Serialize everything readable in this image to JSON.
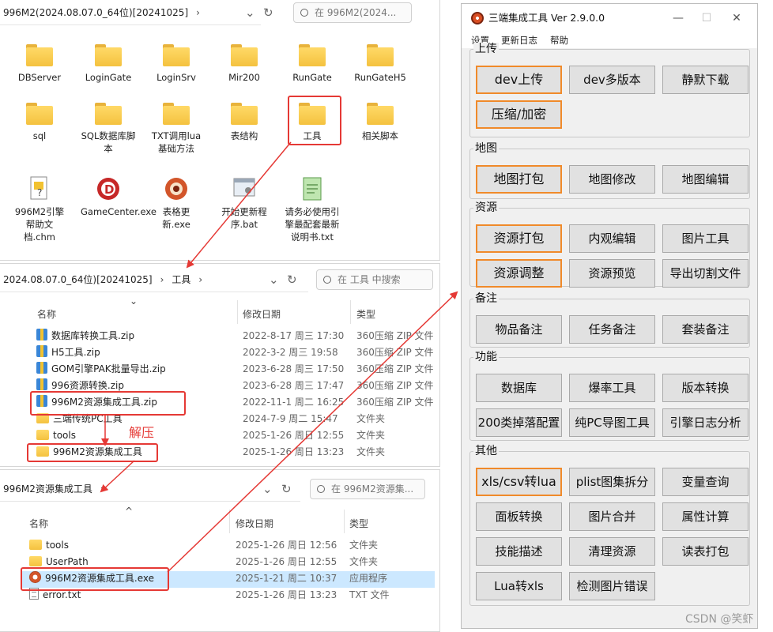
{
  "window1": {
    "breadcrumb": "996M2(2024.08.07.0_64位)[20241025]",
    "search_placeholder": "在 996M2(2024...",
    "tiles": [
      {
        "label": "DBServer",
        "kind": "folder"
      },
      {
        "label": "LoginGate",
        "kind": "folder"
      },
      {
        "label": "LoginSrv",
        "kind": "folder"
      },
      {
        "label": "Mir200",
        "kind": "folder"
      },
      {
        "label": "RunGate",
        "kind": "folder"
      },
      {
        "label": "RunGateH5",
        "kind": "folder"
      },
      {
        "label": "sql",
        "kind": "folder"
      },
      {
        "label": "SQL数据库脚本",
        "kind": "folder"
      },
      {
        "label": "TXT调用lua基础方法",
        "kind": "folder"
      },
      {
        "label": "表结构",
        "kind": "folder"
      },
      {
        "label": "工具",
        "kind": "folder"
      },
      {
        "label": "相关脚本",
        "kind": "folder"
      },
      {
        "label": "996M2引擎帮助文档.chm",
        "kind": "chm"
      },
      {
        "label": "GameCenter.exe",
        "kind": "exe-d"
      },
      {
        "label": "表格更新.exe",
        "kind": "exe-dragon"
      },
      {
        "label": "开始更新程序.bat",
        "kind": "bat"
      },
      {
        "label": "请务必使用引擎最配套最新说明书.txt",
        "kind": "txt"
      }
    ]
  },
  "window2": {
    "breadcrumb_part1": "2024.08.07.0_64位)[20241025]",
    "breadcrumb_part2": "工具",
    "search_placeholder": "在 工具 中搜索",
    "col_name": "名称",
    "col_date": "修改日期",
    "col_type": "类型",
    "rows": [
      {
        "name": "数据库转换工具.zip",
        "date": "2022-8-17 周三 17:30",
        "type": "360压缩 ZIP 文件",
        "kind": "zip"
      },
      {
        "name": "H5工具.zip",
        "date": "2022-3-2 周三 19:58",
        "type": "360压缩 ZIP 文件",
        "kind": "zip"
      },
      {
        "name": "GOM引擎PAK批量导出.zip",
        "date": "2023-6-28 周三 17:50",
        "type": "360压缩 ZIP 文件",
        "kind": "zip"
      },
      {
        "name": "996资源转换.zip",
        "date": "2023-6-28 周三 17:47",
        "type": "360压缩 ZIP 文件",
        "kind": "zip"
      },
      {
        "name": "996M2资源集成工具.zip",
        "date": "2022-11-1 周二 16:25",
        "type": "360压缩 ZIP 文件",
        "kind": "zip"
      },
      {
        "name": "三端传统PC工具",
        "date": "2024-7-9 周二 15:47",
        "type": "文件夹",
        "kind": "folder"
      },
      {
        "name": "tools",
        "date": "2025-1-26 周日 12:55",
        "type": "文件夹",
        "kind": "folder"
      },
      {
        "name": "996M2资源集成工具",
        "date": "2025-1-26 周日 13:23",
        "type": "文件夹",
        "kind": "folder"
      }
    ]
  },
  "window3": {
    "breadcrumb": "996M2资源集成工具",
    "search_placeholder": "在 996M2资源集...",
    "col_name": "名称",
    "col_date": "修改日期",
    "col_type": "类型",
    "rows": [
      {
        "name": "tools",
        "date": "2025-1-26 周日 12:56",
        "type": "文件夹",
        "kind": "folder"
      },
      {
        "name": "UserPath",
        "date": "2025-1-26 周日 12:55",
        "type": "文件夹",
        "kind": "folder"
      },
      {
        "name": "996M2资源集成工具.exe",
        "date": "2025-1-21 周二 10:37",
        "type": "应用程序",
        "kind": "exe"
      },
      {
        "name": "error.txt",
        "date": "2025-1-26 周日 13:23",
        "type": "TXT 文件",
        "kind": "txt"
      }
    ]
  },
  "annotation": {
    "unzip_label": "解压",
    "color": "#e53935"
  },
  "tool": {
    "title": "三端集成工具 Ver 2.9.0.0",
    "menu": [
      "设置",
      "更新日志",
      "帮助"
    ],
    "highlight_color": "#f08a2a",
    "groups": [
      {
        "title": "上传",
        "buttons": [
          {
            "label": "dev上传",
            "hl": true
          },
          {
            "label": "dev多版本",
            "hl": false
          },
          {
            "label": "静默下载",
            "hl": false
          },
          {
            "label": "压缩/加密",
            "hl": true
          }
        ]
      },
      {
        "title": "地图",
        "buttons": [
          {
            "label": "地图打包",
            "hl": true
          },
          {
            "label": "地图修改",
            "hl": false
          },
          {
            "label": "地图编辑",
            "hl": false
          }
        ]
      },
      {
        "title": "资源",
        "buttons": [
          {
            "label": "资源打包",
            "hl": true
          },
          {
            "label": "内观编辑",
            "hl": false
          },
          {
            "label": "图片工具",
            "hl": false
          },
          {
            "label": "资源调整",
            "hl": true
          },
          {
            "label": "资源预览",
            "hl": false
          },
          {
            "label": "导出切割文件",
            "hl": false
          }
        ]
      },
      {
        "title": "备注",
        "buttons": [
          {
            "label": "物品备注",
            "hl": false
          },
          {
            "label": "任务备注",
            "hl": false
          },
          {
            "label": "套装备注",
            "hl": false
          }
        ]
      },
      {
        "title": "功能",
        "buttons": [
          {
            "label": "数据库",
            "hl": false
          },
          {
            "label": "爆率工具",
            "hl": false
          },
          {
            "label": "版本转换",
            "hl": false
          },
          {
            "label": "200类掉落配置",
            "hl": false
          },
          {
            "label": "纯PC导图工具",
            "hl": false
          },
          {
            "label": "引擎日志分析",
            "hl": false
          }
        ]
      },
      {
        "title": "其他",
        "buttons": [
          {
            "label": "xls/csv转lua",
            "hl": true
          },
          {
            "label": "plist图集拆分",
            "hl": false
          },
          {
            "label": "变量查询",
            "hl": false
          },
          {
            "label": "面板转换",
            "hl": false
          },
          {
            "label": "图片合并",
            "hl": false
          },
          {
            "label": "属性计算",
            "hl": false
          },
          {
            "label": "技能描述",
            "hl": false
          },
          {
            "label": "清理资源",
            "hl": false
          },
          {
            "label": "读表打包",
            "hl": false
          },
          {
            "label": "Lua转xls",
            "hl": false
          },
          {
            "label": "检测图片错误",
            "hl": false
          }
        ]
      }
    ]
  },
  "watermark": "CSDN @笑虾"
}
